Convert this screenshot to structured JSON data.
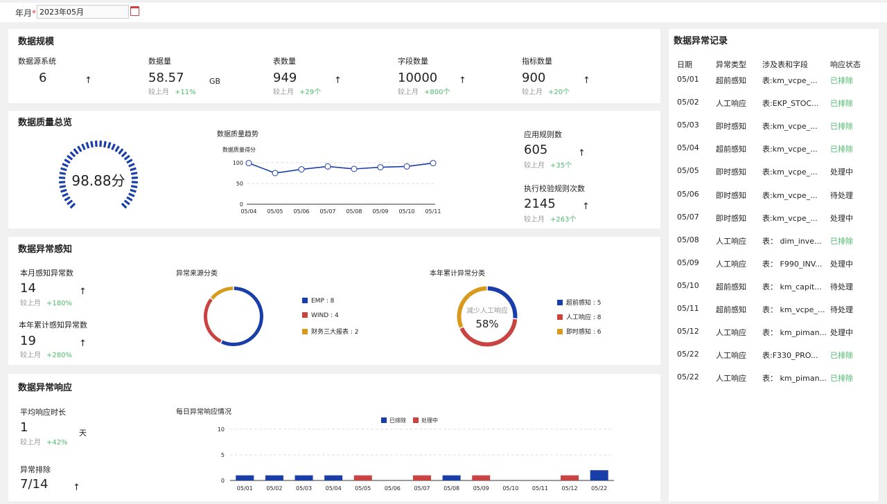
{
  "filter": {
    "label": "年月",
    "required_mark": "*",
    "value": "2023年05月"
  },
  "scale": {
    "title": "数据规模",
    "items": [
      {
        "label": "数据源系统",
        "value": "6",
        "unit": "",
        "compare": "",
        "delta": ""
      },
      {
        "label": "数据量",
        "value": "58.57",
        "unit": "GB",
        "compare": "较上月",
        "delta": "+11%"
      },
      {
        "label": "表数量",
        "value": "949",
        "unit": "",
        "compare": "较上月",
        "delta": "+29个"
      },
      {
        "label": "字段数量",
        "value": "10000",
        "unit": "",
        "compare": "较上月",
        "delta": "+800个"
      },
      {
        "label": "指标数量",
        "value": "900",
        "unit": "",
        "compare": "较上月",
        "delta": "+20个"
      }
    ]
  },
  "quality": {
    "title": "数据质量总览",
    "score": "98.88分",
    "score_value": 98.88,
    "trend_title": "数据质量趋势",
    "trend_ylabel": "数据质量得分",
    "rules_label": "应用规则数",
    "rules_value": "605",
    "rules_compare": "较上月",
    "rules_delta": "+35个",
    "exec_label": "执行校验规则次数",
    "exec_value": "2145",
    "exec_compare": "较上月",
    "exec_delta": "+263个"
  },
  "perception": {
    "title": "数据异常感知",
    "month_label": "本月感知异常数",
    "month_value": "14",
    "month_compare": "较上月",
    "month_delta": "+180%",
    "year_label": "本年累计感知异常数",
    "year_value": "19",
    "year_compare": "较上月",
    "year_delta": "+280%",
    "source_title": "异常来源分类",
    "category_title": "本年累计异常分类",
    "donut_center_label": "减少人工响应",
    "donut_center_value": "58%"
  },
  "response": {
    "title": "数据异常响应",
    "avg_label": "平均响应时长",
    "avg_value": "1",
    "avg_unit": "天",
    "avg_compare": "较上月",
    "avg_delta": "+42%",
    "resolved_label": "异常排除",
    "resolved_value": "7/14",
    "daily_title": "每日异常响应情况"
  },
  "records": {
    "title": "数据异常记录",
    "headers": [
      "日期",
      "异常类型",
      "涉及表和字段",
      "响应状态"
    ],
    "rows": [
      {
        "date": "05/01",
        "type": "超前感知",
        "table": "表:km_vcpe_...",
        "status": "已排除"
      },
      {
        "date": "05/02",
        "type": "人工响应",
        "table": "表:EKP_STOC...",
        "status": "已排除"
      },
      {
        "date": "05/03",
        "type": "即时感知",
        "table": "表:km_vcpe_...",
        "status": "已排除"
      },
      {
        "date": "05/04",
        "type": "超前感知",
        "table": "表:km_vcpe_...",
        "status": "已排除"
      },
      {
        "date": "05/05",
        "type": "即时感知",
        "table": "表:km_vcpe_...",
        "status": "处理中"
      },
      {
        "date": "05/06",
        "type": "即时感知",
        "table": "表:km_vcpe_...",
        "status": "待处理"
      },
      {
        "date": "05/07",
        "type": "即时感知",
        "table": "表:km_vcpe_...",
        "status": "处理中"
      },
      {
        "date": "05/08",
        "type": "人工响应",
        "table": "表： dim_inve...",
        "status": "已排除"
      },
      {
        "date": "05/09",
        "type": "人工响应",
        "table": "表： F990_INV...",
        "status": "处理中"
      },
      {
        "date": "05/10",
        "type": "超前感知",
        "table": "表： km_capit...",
        "status": "待处理"
      },
      {
        "date": "05/11",
        "type": "超前感知",
        "table": "表： km_vcpe_...",
        "status": "待处理"
      },
      {
        "date": "05/12",
        "type": "人工响应",
        "table": "表： km_piman...",
        "status": "处理中"
      },
      {
        "date": "05/22",
        "type": "人工响应",
        "table": "表:F330_PRO...",
        "status": "已排除"
      },
      {
        "date": "05/22",
        "type": "人工响应",
        "table": "表： km_piman...",
        "status": "已排除"
      }
    ]
  },
  "colors": {
    "blue": "#1a3ea8",
    "red": "#c94441",
    "gold": "#d89a1c",
    "green": "#4cbb6c"
  },
  "chart_data": [
    {
      "type": "line",
      "title": "数据质量趋势",
      "ylabel": "数据质量得分",
      "x": [
        "05/04",
        "05/05",
        "05/06",
        "05/07",
        "05/08",
        "05/09",
        "05/10",
        "05/11"
      ],
      "values": [
        99,
        75,
        84,
        91,
        85,
        89,
        91,
        99
      ],
      "ylim": [
        0,
        100
      ],
      "yticks": [
        0,
        50,
        100
      ]
    },
    {
      "type": "pie",
      "title": "异常来源分类",
      "labels": [
        "EMP : 8",
        "WIND : 4",
        "财务三大报表 : 2"
      ],
      "values": [
        8,
        4,
        2
      ],
      "colors": [
        "#1a3ea8",
        "#c94441",
        "#d89a1c"
      ]
    },
    {
      "type": "pie",
      "title": "本年累计异常分类",
      "labels": [
        "超前感知 : 5",
        "人工响应 : 8",
        "即时感知 : 6"
      ],
      "values": [
        5,
        8,
        6
      ],
      "colors": [
        "#1a3ea8",
        "#c94441",
        "#d89a1c"
      ]
    },
    {
      "type": "bar",
      "title": "每日异常响应情况",
      "categories": [
        "05/01",
        "05/02",
        "05/03",
        "05/04",
        "05/05",
        "05/06",
        "05/07",
        "05/08",
        "05/09",
        "05/10",
        "05/11",
        "05/12",
        "05/22"
      ],
      "series": [
        {
          "name": "已排除",
          "values": [
            1,
            1,
            1,
            1,
            0,
            0,
            0,
            1,
            0,
            0,
            0,
            0,
            2
          ]
        },
        {
          "name": "处理中",
          "values": [
            0,
            0,
            0,
            0,
            1,
            0,
            1,
            0,
            1,
            0,
            0,
            1,
            0
          ]
        }
      ],
      "ylim": [
        0,
        10
      ],
      "yticks": [
        0,
        5,
        10
      ]
    }
  ]
}
